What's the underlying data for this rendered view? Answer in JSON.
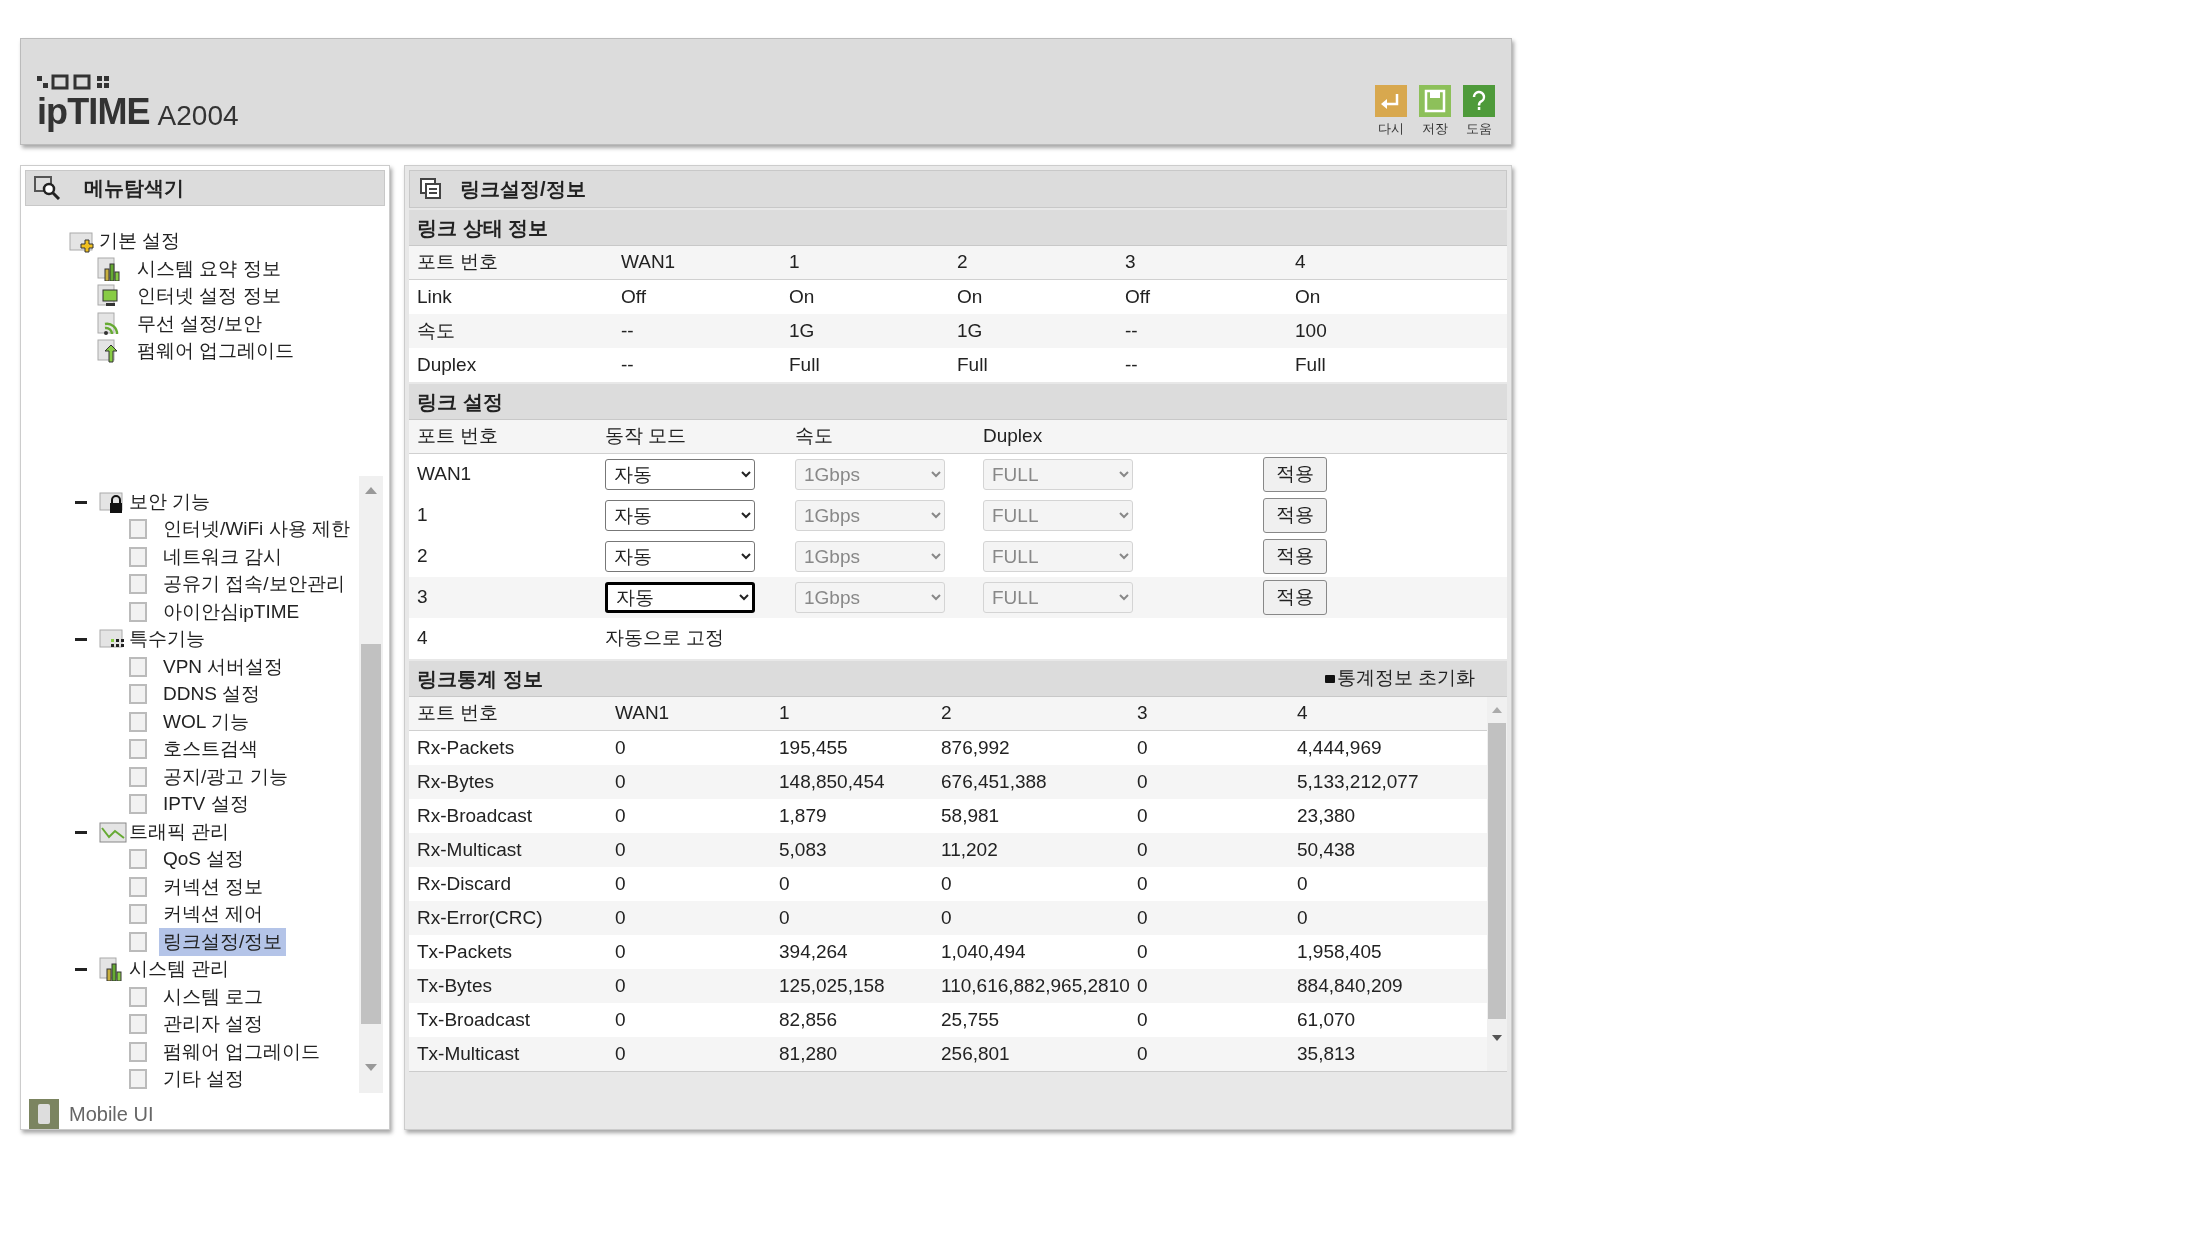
{
  "header": {
    "logo": "ipTIME",
    "model": "A2004",
    "tools": [
      {
        "kind": "undo",
        "label": "다시"
      },
      {
        "kind": "save",
        "label": "저장"
      },
      {
        "kind": "help",
        "label": "도움"
      }
    ]
  },
  "sidebar": {
    "title": "메뉴탐색기",
    "fixed": [
      {
        "label": "기본 설정",
        "kind": "settings",
        "children": [
          {
            "label": "시스템 요약 정보",
            "kind": "chart"
          },
          {
            "label": "인터넷 설정 정보",
            "kind": "monitor"
          },
          {
            "label": "무선 설정/보안",
            "kind": "wireless"
          },
          {
            "label": "펌웨어 업그레이드",
            "kind": "upgrade"
          }
        ]
      }
    ],
    "groups": [
      {
        "label": "보안 기능",
        "kind": "lock",
        "expanded": true,
        "children": [
          {
            "label": "인터넷/WiFi 사용 제한",
            "selected": false
          },
          {
            "label": "네트워크 감시",
            "selected": false
          },
          {
            "label": "공유기 접속/보안관리",
            "selected": false
          },
          {
            "label": "아이안심ipTIME",
            "selected": false
          }
        ]
      },
      {
        "label": "특수기능",
        "kind": "grid",
        "expanded": true,
        "children": [
          {
            "label": "VPN 서버설정",
            "selected": false
          },
          {
            "label": "DDNS 설정",
            "selected": false
          },
          {
            "label": "WOL 기능",
            "selected": false
          },
          {
            "label": "호스트검색",
            "selected": false
          },
          {
            "label": "공지/광고 기능",
            "selected": false
          },
          {
            "label": "IPTV 설정",
            "selected": false
          }
        ]
      },
      {
        "label": "트래픽 관리",
        "kind": "traffic",
        "expanded": true,
        "children": [
          {
            "label": "QoS 설정",
            "selected": false
          },
          {
            "label": "커넥션 정보",
            "selected": false
          },
          {
            "label": "커넥션 제어",
            "selected": false
          },
          {
            "label": "링크설정/정보",
            "selected": true
          }
        ]
      },
      {
        "label": "시스템 관리",
        "kind": "chart",
        "expanded": true,
        "children": [
          {
            "label": "시스템 로그",
            "selected": false
          },
          {
            "label": "관리자 설정",
            "selected": false
          },
          {
            "label": "펌웨어 업그레이드",
            "selected": false
          },
          {
            "label": "기타 설정",
            "selected": false
          }
        ]
      }
    ],
    "footer": "Mobile UI"
  },
  "main": {
    "title": "링크설정/정보",
    "status": {
      "title": "링크 상태 정보",
      "columns": [
        "포트 번호",
        "WAN1",
        "1",
        "2",
        "3",
        "4"
      ],
      "rows": [
        [
          "Link",
          "Off",
          "On",
          "On",
          "Off",
          "On"
        ],
        [
          "속도",
          "--",
          "1G",
          "1G",
          "--",
          "100"
        ],
        [
          "Duplex",
          "--",
          "Full",
          "Full",
          "--",
          "Full"
        ]
      ]
    },
    "settings": {
      "title": "링크 설정",
      "columns": [
        "포트 번호",
        "동작 모드",
        "속도",
        "Duplex"
      ],
      "rows": [
        {
          "port": "WAN1",
          "kind": "select",
          "mode": "자동",
          "focused": false,
          "speed": "1Gbps",
          "duplex": "FULL",
          "disabled": true,
          "button": "적용"
        },
        {
          "port": "1",
          "kind": "select",
          "mode": "자동",
          "focused": false,
          "speed": "1Gbps",
          "duplex": "FULL",
          "disabled": true,
          "button": "적용"
        },
        {
          "port": "2",
          "kind": "select",
          "mode": "자동",
          "focused": false,
          "speed": "1Gbps",
          "duplex": "FULL",
          "disabled": true,
          "button": "적용"
        },
        {
          "port": "3",
          "kind": "select",
          "mode": "자동",
          "focused": true,
          "speed": "1Gbps",
          "duplex": "FULL",
          "disabled": true,
          "button": "적용"
        },
        {
          "port": "4",
          "kind": "fixed",
          "mode": "자동으로 고정"
        }
      ]
    },
    "stats": {
      "title": "링크통계 정보",
      "reset": "통계정보 초기화",
      "columns": [
        "포트 번호",
        "WAN1",
        "1",
        "2",
        "3",
        "4"
      ],
      "rows": [
        [
          "Rx-Packets",
          "0",
          "195,455",
          "876,992",
          "0",
          "4,444,969"
        ],
        [
          "Rx-Bytes",
          "0",
          "148,850,454",
          "676,451,388",
          "0",
          "5,133,212,077"
        ],
        [
          "Rx-Broadcast",
          "0",
          "1,879",
          "58,981",
          "0",
          "23,380"
        ],
        [
          "Rx-Multicast",
          "0",
          "5,083",
          "11,202",
          "0",
          "50,438"
        ],
        [
          "Rx-Discard",
          "0",
          "0",
          "0",
          "0",
          "0"
        ],
        [
          "Rx-Error(CRC)",
          "0",
          "0",
          "0",
          "0",
          "0"
        ],
        [
          "Tx-Packets",
          "0",
          "394,264",
          "1,040,494",
          "0",
          "1,958,405"
        ],
        [
          "Tx-Bytes",
          "0",
          "125,025,158",
          "110,616,882,965,2810",
          "0",
          "884,840,209"
        ],
        [
          "Tx-Broadcast",
          "0",
          "82,856",
          "25,755",
          "0",
          "61,070"
        ],
        [
          "Tx-Multicast",
          "0",
          "81,280",
          "256,801",
          "0",
          "35,813"
        ]
      ]
    }
  }
}
